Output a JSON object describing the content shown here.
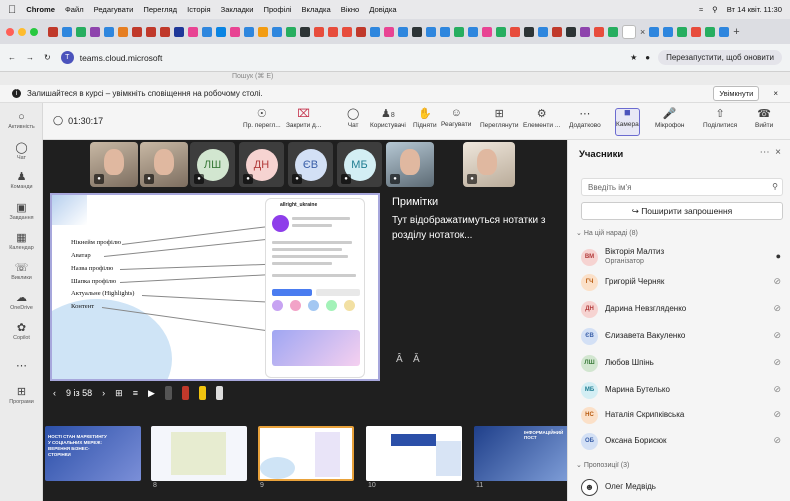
{
  "menubar": {
    "browser": "Chrome",
    "items": [
      "Файл",
      "Редагувати",
      "Перегляд",
      "Історія",
      "Закладки",
      "Профілі",
      "Вкладка",
      "Вікно",
      "Довідка"
    ],
    "clock": "Вт 14 квіт. 11:30"
  },
  "address": {
    "url": "teams.cloud.microsoft",
    "relaunch": "Перезапустити, щоб оновити"
  },
  "teams_search": "Пошук (⌘ E)",
  "info": {
    "message": "Залишайтеся в курсі – увімкніть сповіщення на робочому столі.",
    "button": "Увімкнути"
  },
  "rail": [
    {
      "label": "Активність",
      "icon": "bell-icon"
    },
    {
      "label": "Чат",
      "icon": "chat-icon"
    },
    {
      "label": "Команди",
      "icon": "teams-icon"
    },
    {
      "label": "Завдання",
      "icon": "tasks-icon"
    },
    {
      "label": "Календар",
      "icon": "calendar-icon"
    },
    {
      "label": "Виклики",
      "icon": "phone-icon"
    },
    {
      "label": "OneDrive",
      "icon": "cloud-icon"
    },
    {
      "label": "Copilot",
      "icon": "copilot-icon"
    },
    {
      "label": "",
      "icon": "more-icon"
    },
    {
      "label": "Програми",
      "icon": "apps-icon"
    }
  ],
  "toolbar": {
    "timer": "01:30:17",
    "items": [
      "Пр. перегл...",
      "Закрити д...",
      "Чат",
      "Користувачі",
      "Підняти",
      "Реагувати",
      "Переглянути",
      "Елементи ...",
      "Додатково",
      "Камера",
      "Мікрофон",
      "Поділитися",
      "Вийти"
    ],
    "people_count": "8"
  },
  "video_tiles": [
    {
      "type": "photo"
    },
    {
      "type": "photo"
    },
    {
      "type": "initials",
      "text": "ЛШ",
      "bg": "#d2e6d0",
      "fg": "#3a7a3a"
    },
    {
      "type": "initials",
      "text": "ДН",
      "bg": "#f6d3d1",
      "fg": "#b23b3b"
    },
    {
      "type": "initials",
      "text": "ЄВ",
      "bg": "#d3e0f5",
      "fg": "#3a5fa8"
    },
    {
      "type": "initials",
      "text": "МБ",
      "bg": "#d3eef4",
      "fg": "#1f7d92"
    },
    {
      "type": "photo"
    },
    {
      "type": "photo"
    }
  ],
  "slide": {
    "labels": [
      "Нікнейм профілю",
      "Аватар",
      "Назва профілю",
      "Шапка профілю",
      "Актуальне (Highlights)",
      "Контент"
    ],
    "phone_handle": "allright_ukraine"
  },
  "notes": {
    "title": "Примітки",
    "text": "Тут відображатимуться нотатки з розділу нотаток..."
  },
  "slide_nav": {
    "counter": "9 із 58"
  },
  "thumbs": [
    {
      "num": "",
      "title": "НОСТІ СТАН МАРКЕТИНГУ У СОЦІАЛЬНИХ МЕРЕЖ: ВЕРЕННЯ БІЗНЕС-СТОРІНКИ"
    },
    {
      "num": "8",
      "title": ""
    },
    {
      "num": "9",
      "title": ""
    },
    {
      "num": "10",
      "title": ""
    },
    {
      "num": "11",
      "title": "ІНФОРМАЦІЙНИЙ ПОСТ"
    }
  ],
  "panel": {
    "title": "Учасники",
    "search_placeholder": "Введіть ім'я",
    "share": "Поширити запрошення",
    "in_meeting": "На цій нараді (8)",
    "suggested": "Пропозиції (3)",
    "people": [
      {
        "initials": "ВМ",
        "name": "Вікторія Малтиз",
        "role": "Організатор",
        "bg": "#f6d3d1",
        "fg": "#b23b3b",
        "mic": "on"
      },
      {
        "initials": "ГЧ",
        "name": "Григорій Черняк",
        "role": "",
        "bg": "#fbe0c8",
        "fg": "#b85b10",
        "mic": "off"
      },
      {
        "initials": "ДН",
        "name": "Дарина Невзгляденко",
        "role": "",
        "bg": "#f6d3d1",
        "fg": "#b23b3b",
        "mic": "off"
      },
      {
        "initials": "ЄВ",
        "name": "Єлизавета Вакуленко",
        "role": "",
        "bg": "#d3e0f5",
        "fg": "#3a5fa8",
        "mic": "off"
      },
      {
        "initials": "ЛШ",
        "name": "Любов Шпінь",
        "role": "",
        "bg": "#d2e6d0",
        "fg": "#3a7a3a",
        "mic": "off"
      },
      {
        "initials": "МБ",
        "name": "Марина Бутелько",
        "role": "",
        "bg": "#d3eef4",
        "fg": "#1f7d92",
        "mic": "off"
      },
      {
        "initials": "НС",
        "name": "Наталія Скрипківська",
        "role": "",
        "bg": "#fbe0c8",
        "fg": "#b85b10",
        "mic": "off"
      },
      {
        "initials": "ОБ",
        "name": "Оксана Борисюк",
        "role": "",
        "bg": "#d3e0f5",
        "fg": "#3a5fa8",
        "mic": "off"
      }
    ],
    "suggested_people": [
      {
        "name": "Олег Медвідь"
      }
    ]
  }
}
